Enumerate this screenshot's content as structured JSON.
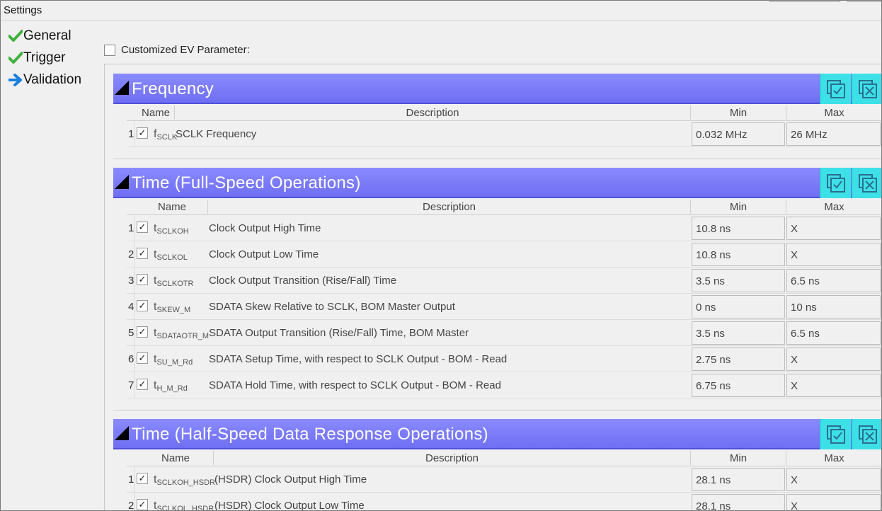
{
  "window": {
    "title": "Settings"
  },
  "nav": {
    "items": [
      {
        "label": "General",
        "icon": "check-icon"
      },
      {
        "label": "Trigger",
        "icon": "check-icon"
      },
      {
        "label": "Validation",
        "icon": "arrow-right-icon"
      }
    ]
  },
  "ev": {
    "label": "Customized EV Parameter:"
  },
  "colors": {
    "header": "#7a7af8",
    "header_button": "#3ee0e8",
    "check_green": "#3fb23f",
    "arrow_blue": "#1a7fe0"
  },
  "columns": {
    "name": "Name",
    "description": "Description",
    "min": "Min",
    "max": "Max"
  },
  "sections": [
    {
      "title": "Frequency",
      "rows": [
        {
          "num": "1",
          "sym": "f",
          "sub": "SCLK",
          "desc": "SCLK Frequency",
          "min": "0.032 MHz",
          "max": "26 MHz"
        }
      ]
    },
    {
      "title": "Time (Full-Speed Operations)",
      "rows": [
        {
          "num": "1",
          "sym": "t",
          "sub": "SCLKOH",
          "desc": "Clock Output High Time",
          "min": "10.8 ns",
          "max": "X"
        },
        {
          "num": "2",
          "sym": "t",
          "sub": "SCLKOL",
          "desc": "Clock Output Low Time",
          "min": "10.8 ns",
          "max": "X"
        },
        {
          "num": "3",
          "sym": "t",
          "sub": "SCLKOTR",
          "desc": "Clock Output Transition (Rise/Fall) Time",
          "min": "3.5 ns",
          "max": "6.5 ns"
        },
        {
          "num": "4",
          "sym": "t",
          "sub": "SKEW_M",
          "desc": "SDATA Skew Relative to SCLK, BOM Master Output",
          "min": "0 ns",
          "max": "10 ns"
        },
        {
          "num": "5",
          "sym": "t",
          "sub": "SDATAOTR_M",
          "desc": "SDATA Output Transition (Rise/Fall) Time, BOM Master",
          "min": "3.5 ns",
          "max": "6.5 ns"
        },
        {
          "num": "6",
          "sym": "t",
          "sub": "SU_M_Rd",
          "desc": "SDATA Setup Time, with respect to SCLK Output - BOM - Read",
          "min": "2.75 ns",
          "max": "X"
        },
        {
          "num": "7",
          "sym": "t",
          "sub": "H_M_Rd",
          "desc": "SDATA Hold Time, with respect to SCLK Output - BOM - Read",
          "min": "6.75 ns",
          "max": "X"
        }
      ]
    },
    {
      "title": "Time (Half-Speed Data Response Operations)",
      "rows": [
        {
          "num": "1",
          "sym": "t",
          "sub": "SCLKOH_HSDR",
          "desc": "(HSDR) Clock Output High Time",
          "min": "28.1 ns",
          "max": "X"
        },
        {
          "num": "2",
          "sym": "t",
          "sub": "SCLKOL_HSDR",
          "desc": "(HSDR) Clock Output Low Time",
          "min": "28.1 ns",
          "max": "X"
        }
      ]
    }
  ]
}
